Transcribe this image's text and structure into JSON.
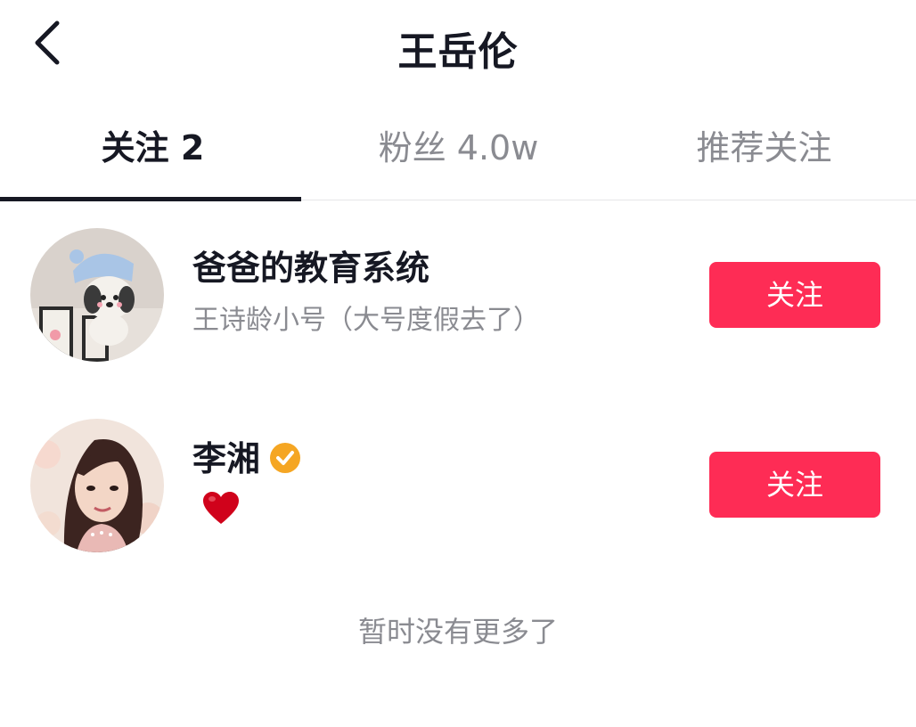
{
  "header": {
    "title": "王岳伦",
    "back_icon": "chevron-left-icon"
  },
  "tabs": [
    {
      "label": "关注 2",
      "active": true
    },
    {
      "label": "粉丝 4.0w",
      "active": false
    },
    {
      "label": "推荐关注",
      "active": false
    }
  ],
  "users": [
    {
      "name": "爸爸的教育系统",
      "description": "王诗龄小号（大号度假去了）",
      "follow_label": "关注",
      "verified": false
    },
    {
      "name": "李湘",
      "description_icon": "heart-icon",
      "follow_label": "关注",
      "verified": true
    }
  ],
  "footer": {
    "no_more_text": "暂时没有更多了"
  },
  "colors": {
    "accent": "#fe2c55",
    "verified": "#f5a623",
    "heart": "#d0021b",
    "text_primary": "#161823",
    "text_secondary": "#8a8b91"
  }
}
